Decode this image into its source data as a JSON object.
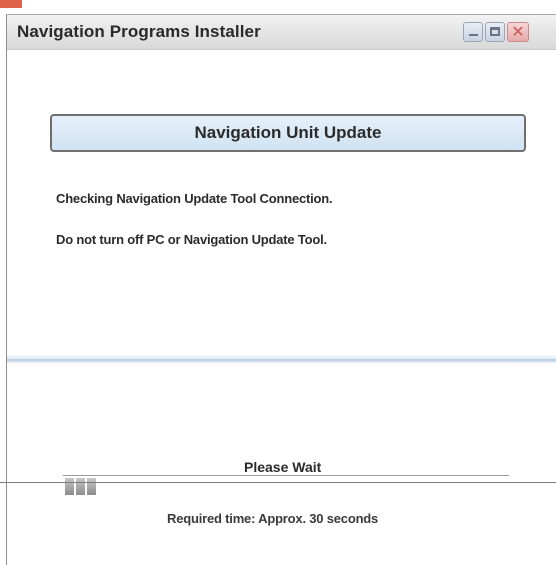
{
  "window": {
    "title": "Navigation Programs Installer",
    "controls": {
      "minimize_icon": "minimize-icon",
      "maximize_icon": "maximize-icon",
      "close_icon": "close-icon",
      "close_glyph": "✕"
    }
  },
  "header": {
    "title": "Navigation Unit Update"
  },
  "status": {
    "line1": "Checking Navigation Update Tool Connection.",
    "line2": "Do not turn off PC or Navigation Update Tool."
  },
  "progress": {
    "label": "Please Wait",
    "blocks_filled": 3,
    "required_time": "Required time: Approx. 30 seconds"
  },
  "colors": {
    "header_fill": "#cfe3f3",
    "separator": "#b9cde1",
    "corner_accent": "#d9462a"
  }
}
